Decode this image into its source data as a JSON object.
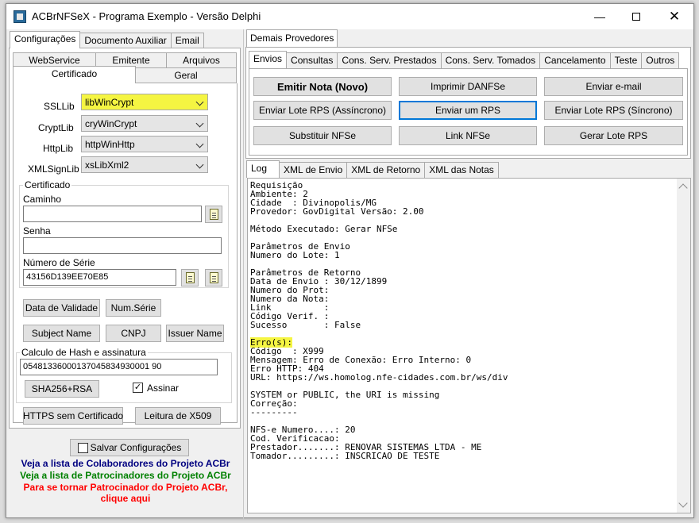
{
  "window": {
    "title": "ACBrNFSeX - Programa Exemplo - Versão Delphi"
  },
  "left_tabs": [
    "Configurações",
    "Documento Auxiliar",
    "Email"
  ],
  "config_tabs_row1": [
    "WebService",
    "Emitente",
    "Arquivos"
  ],
  "config_tabs_row2": [
    "Certificado",
    "Geral"
  ],
  "libs": {
    "ssllib_label": "SSLLib",
    "ssllib_value": "libWinCrypt",
    "cryptlib_label": "CryptLib",
    "cryptlib_value": "cryWinCrypt",
    "httplib_label": "HttpLib",
    "httplib_value": "httpWinHttp",
    "xmlsignlib_label": "XMLSignLib",
    "xmlsignlib_value": "xsLibXml2"
  },
  "certificado": {
    "group_title": "Certificado",
    "caminho_label": "Caminho",
    "caminho_value": "",
    "senha_label": "Senha",
    "senha_value": "",
    "serie_label": "Número de Série",
    "serie_value": "43156D139EE70E85"
  },
  "cert_buttons": {
    "data_validade": "Data de Validade",
    "num_serie": "Num.Série",
    "subject_name": "Subject Name",
    "cnpj": "CNPJ",
    "issuer_name": "Issuer Name"
  },
  "hash": {
    "group_title": "Calculo de Hash e assinatura",
    "value": "05481336000137045834930001 90",
    "sha_button": "SHA256+RSA",
    "assinar_label": "Assinar",
    "assinar_checked": true
  },
  "bottom_buttons": {
    "https": "HTTPS sem Certificado",
    "leitura": "Leitura de X509"
  },
  "salvar": "Salvar Configurações",
  "links": {
    "colaboradores": "Veja a lista de Colaboradores do Projeto ACBr",
    "patrocinadores": "Veja a lista de Patrocinadores do Projeto ACBr",
    "patrocinador_line1": "Para se tornar Patrocinador do Projeto ACBr,",
    "patrocinador_line2": "clique aqui",
    "colors": {
      "navy": "#000080",
      "green": "#008000",
      "red": "#ff0000"
    }
  },
  "right_top_tab": "Demais Provedores",
  "right_tabs": [
    "Envios",
    "Consultas",
    "Cons. Serv. Prestados",
    "Cons. Serv. Tomados",
    "Cancelamento",
    "Teste",
    "Outros"
  ],
  "envios_buttons": {
    "emitir": "Emitir Nota (Novo)",
    "imprimir": "Imprimir DANFSe",
    "email": "Enviar e-mail",
    "lote_assinc": "Enviar Lote RPS (Assíncrono)",
    "um_rps": "Enviar um RPS",
    "lote_sinc": "Enviar Lote RPS (Síncrono)",
    "substituir": "Substituir NFSe",
    "link": "Link NFSe",
    "gerar_lote": "Gerar Lote RPS"
  },
  "log_tabs": [
    "Log",
    "XML de Envio",
    "XML de Retorno",
    "XML das Notas"
  ],
  "log_lines": [
    "Requisição",
    "Ambiente: 2",
    "Cidade  : Divinopolis/MG",
    "Provedor: GovDigital Versão: 2.00",
    "",
    "Método Executado: Gerar NFSe",
    "",
    "Parâmetros de Envio",
    "Numero do Lote: 1",
    "",
    "Parâmetros de Retorno",
    "Data de Envio : 30/12/1899",
    "Numero do Prot:",
    "Numero da Nota:",
    "Link          :",
    "Código Verif. :",
    "Sucesso       : False",
    "",
    "Erro(s):",
    "Código  : X999",
    "Mensagem: Erro de Conexão: Erro Interno: 0",
    "Erro HTTP: 404",
    "URL: https://ws.homolog.nfe-cidades.com.br/ws/div",
    "",
    "SYSTEM or PUBLIC, the URI is missing",
    "Correção:",
    "---------",
    "",
    "NFS-e Numero....: 20",
    "Cod. Verificacao:",
    "Prestador.......: RENOVAR SISTEMAS LTDA - ME",
    "Tomador.........: INSCRICAO DE TESTE"
  ]
}
